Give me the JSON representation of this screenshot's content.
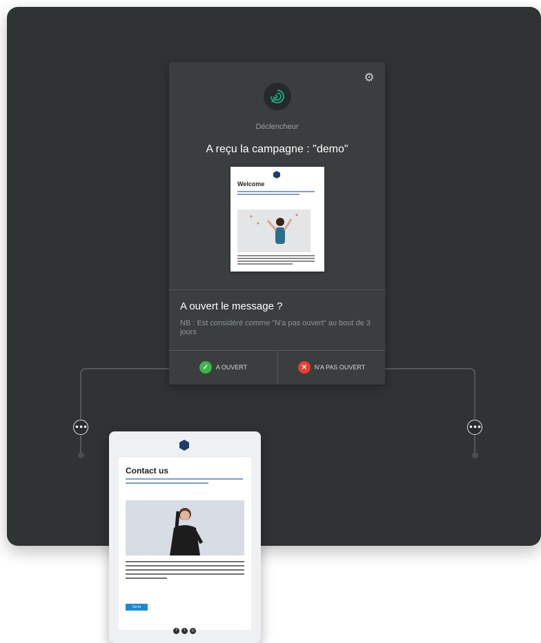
{
  "trigger": {
    "label": "Déclencheur",
    "title": "A reçu la campagne : \"demo\"",
    "settings_icon": "gear-icon",
    "trigger_icon": "target-arrow-icon",
    "accent_color": "#1fa37a"
  },
  "email_preview": {
    "heading": "Welcome"
  },
  "question": {
    "title": "A ouvert le message ?",
    "note": "NB : Est considéré comme \"N'a pas ouvert\" au bout de 3 jours"
  },
  "branches": {
    "opened": {
      "label": "A OUVERT",
      "icon": "check-icon",
      "color": "#3bb54a"
    },
    "not_opened": {
      "label": "N'A PAS OUVERT",
      "icon": "cross-icon",
      "color": "#e8402d"
    }
  },
  "nodes": {
    "menu_icon": "more-horizontal-icon",
    "menu_glyph": "•••"
  },
  "contact_email": {
    "title": "Contact us",
    "cta": "Go to",
    "social_icons": [
      "facebook-icon",
      "twitter-icon",
      "instagram-icon"
    ]
  }
}
